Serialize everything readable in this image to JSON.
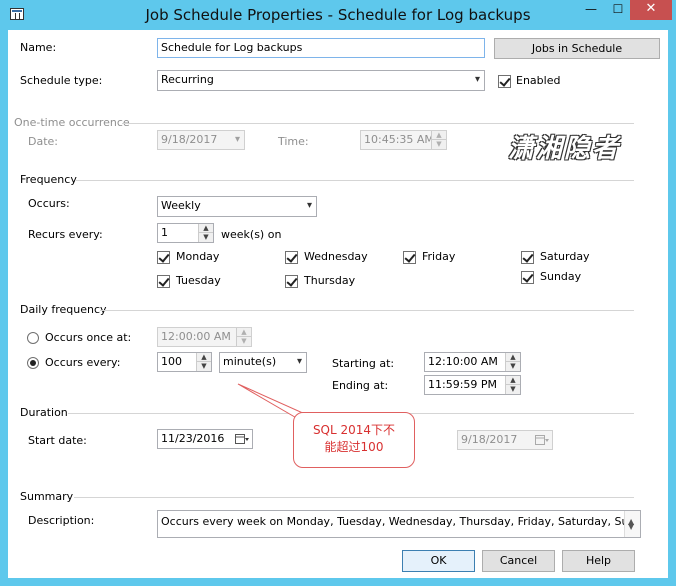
{
  "window": {
    "title": "Job Schedule Properties - Schedule for Log backups",
    "min_glyph": "—",
    "max_glyph": "☐",
    "close_glyph": "✕"
  },
  "name": {
    "label": "Name:",
    "value": "Schedule for Log backups"
  },
  "jobs_in_schedule_button": "Jobs in Schedule",
  "schedule_type": {
    "label": "Schedule type:",
    "value": "Recurring",
    "enabled_label": "Enabled",
    "enabled": true
  },
  "one_time": {
    "heading": "One-time occurrence",
    "date_label": "Date:",
    "date_value": "9/18/2017",
    "time_label": "Time:",
    "time_value": "10:45:35 AM"
  },
  "frequency": {
    "heading": "Frequency",
    "occurs_label": "Occurs:",
    "occurs_value": "Weekly",
    "recurs_label": "Recurs every:",
    "recurs_value": "1",
    "recurs_unit": "week(s) on",
    "days": {
      "monday": "Monday",
      "tuesday": "Tuesday",
      "wednesday": "Wednesday",
      "thursday": "Thursday",
      "friday": "Friday",
      "saturday": "Saturday",
      "sunday": "Sunday"
    }
  },
  "daily": {
    "heading": "Daily frequency",
    "once_label": "Occurs once at:",
    "once_value": "12:00:00 AM",
    "every_label": "Occurs every:",
    "every_value": "100",
    "every_unit": "minute(s)",
    "starting_label": "Starting at:",
    "starting_value": "12:10:00 AM",
    "ending_label": "Ending at:",
    "ending_value": "11:59:59 PM"
  },
  "duration": {
    "heading": "Duration",
    "start_label": "Start date:",
    "start_value": "11/23/2016",
    "end_value": "9/18/2017"
  },
  "summary": {
    "heading": "Summary",
    "desc_label": "Description:",
    "desc_value": "Occurs every week on Monday, Tuesday, Wednesday, Thursday, Friday, Saturday, Sunday every"
  },
  "annotation": {
    "line1": "SQL 2014下不",
    "line2": "能超过100"
  },
  "watermark": "潇湘隐者",
  "buttons": {
    "ok": "OK",
    "cancel": "Cancel",
    "help": "Help"
  },
  "colors": {
    "titlebar": "#5ec8ec",
    "close": "#c75050",
    "callout": "#d83030"
  }
}
